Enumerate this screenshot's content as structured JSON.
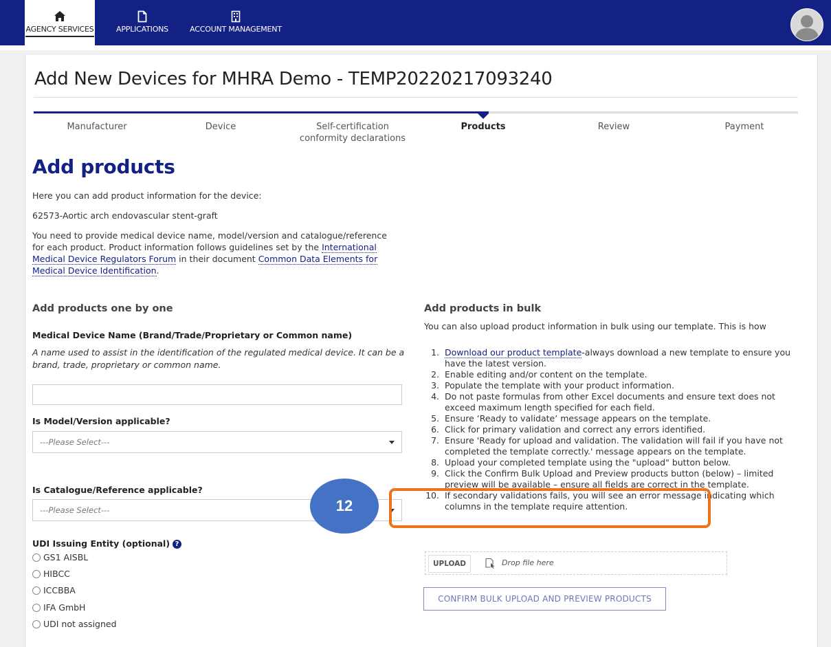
{
  "nav": {
    "items": [
      {
        "label": "AGENCY SERVICES",
        "icon": "home-icon"
      },
      {
        "label": "APPLICATIONS",
        "icon": "document-icon"
      },
      {
        "label": "ACCOUNT MANAGEMENT",
        "icon": "building-icon"
      }
    ],
    "avatar_icon": "user-avatar-icon"
  },
  "page": {
    "title": "Add New Devices for MHRA Demo - TEMP20220217093240"
  },
  "stepper": {
    "steps": [
      {
        "label": "Manufacturer"
      },
      {
        "label": "Device"
      },
      {
        "label": "Self-certification conformity declarations"
      },
      {
        "label": "Products"
      },
      {
        "label": "Review"
      },
      {
        "label": "Payment"
      }
    ],
    "active_index": 3
  },
  "main": {
    "heading": "Add products",
    "intro": "Here you can add product information for the device:",
    "device": "62573-Aortic arch endovascular stent-graft",
    "para_text_1": "You need to provide medical device name, model/version and catalogue/reference for each product. Product information follows guidelines set by the ",
    "link_imdrf": "International Medical Device Regulators Forum",
    "para_text_2": " in their document ",
    "link_cde": "Common Data Elements for Medical Device Identification",
    "para_text_3": "."
  },
  "one_by_one": {
    "heading": "Add products one by one",
    "name_label": "Medical Device Name (Brand/Trade/Proprietary or Common name)",
    "name_hint": "A name used to assist in the identification of the regulated medical device. It can be a brand, trade, proprietary or common name.",
    "name_value": "",
    "model_label": "Is Model/Version applicable?",
    "model_select": "---Please Select---",
    "catalogue_label": "Is Catalogue/Reference applicable?",
    "catalogue_select": "---Please Select---",
    "udi_label": "UDI Issuing Entity (optional)",
    "udi_options": [
      "GS1 AISBL",
      "HIBCC",
      "ICCBBA",
      "IFA GmbH",
      "UDI not assigned"
    ]
  },
  "bulk": {
    "heading": "Add products in bulk",
    "intro": "You can also upload product information in bulk using our template. This is how",
    "steps": [
      {
        "num": "1.",
        "link": "Download our product template",
        "text": "-always download a new template to ensure you have the latest version."
      },
      {
        "num": "2.",
        "text": "Enable editing and/or content on the template."
      },
      {
        "num": "3.",
        "text": "Populate the template with your product information."
      },
      {
        "num": "4.",
        "text": "Do not paste formulas from other Excel documents and ensure text does not exceed maximum length specified for each field."
      },
      {
        "num": "5.",
        "text": "Ensure ‘Ready to validate’ message appears on the template."
      },
      {
        "num": "6.",
        "text": "Click for primary validation and correct any errors identified."
      },
      {
        "num": "7.",
        "text": "Ensure 'Ready for upload and validation. The validation will fail if you have not completed the template correctly.' message appears on the template."
      },
      {
        "num": "8.",
        "text": "Upload your completed template using the \"upload\" button below."
      },
      {
        "num": "9.",
        "text": "Click the Confirm Bulk Upload and Preview products button (below) – limited preview will be available – ensure all fields are correct in the template."
      },
      {
        "num": "10.",
        "text": "If secondary validations fails, you will see an error message indicating which columns in the template require attention."
      }
    ],
    "upload_label": "UPLOAD",
    "drop_text": "Drop file here",
    "confirm_label": "CONFIRM BULK UPLOAD AND PREVIEW PRODUCTS"
  },
  "annotation": {
    "marker": "12",
    "highlight_color": "#f0721d",
    "marker_color": "#4472c4"
  },
  "colors": {
    "brand": "#132185",
    "nav_bg": "#132185"
  }
}
